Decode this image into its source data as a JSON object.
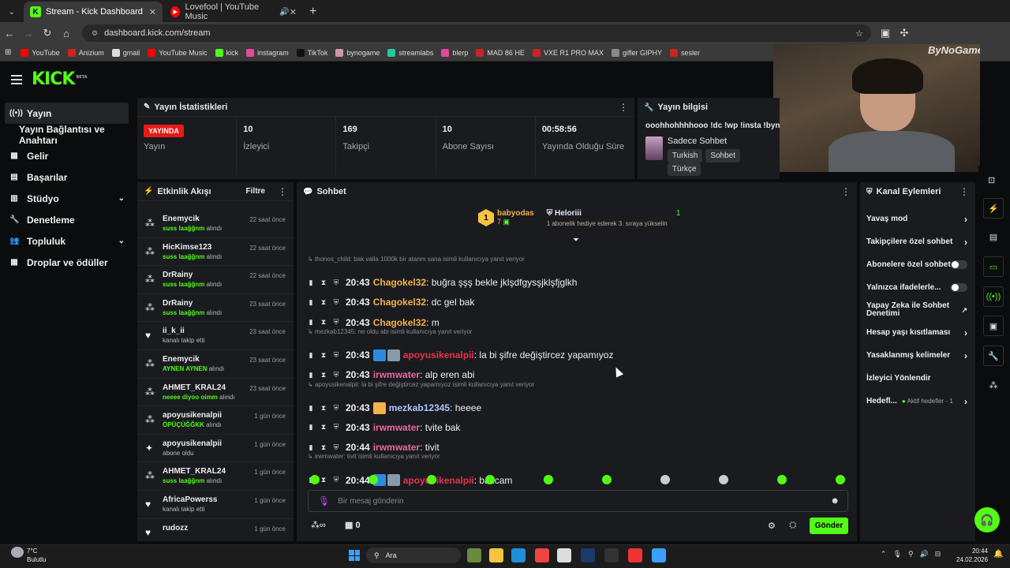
{
  "browser": {
    "tabs": [
      {
        "title": "Stream - Kick Dashboard",
        "active": true
      },
      {
        "title": "Lovefool | YouTube Music",
        "active": false
      }
    ],
    "url": "dashboard.kick.com/stream",
    "profile": "ByNoGame",
    "bookmarks": [
      "YouTube",
      "Anizium",
      "gmail",
      "YouTube Music",
      "kick",
      "instagram",
      "TikTok",
      "bynogame",
      "streamlabs",
      "blerp",
      "MAD 86 HE",
      "VXE R1 PRO MAX",
      "gifler GIPHY",
      "sesler"
    ]
  },
  "logo": {
    "text": "KICK",
    "beta": "BETA"
  },
  "sidebar": {
    "items": [
      {
        "label": "Yayın",
        "icon": "broadcast-icon",
        "active": true
      },
      {
        "label": "Yayın Bağlantısı ve Anahtarı",
        "icon": "",
        "active": false
      },
      {
        "label": "Gelir",
        "icon": "dollar-icon",
        "active": false
      },
      {
        "label": "Başarılar",
        "icon": "trophy-icon",
        "active": false
      },
      {
        "label": "Stüdyo",
        "icon": "studio-icon",
        "chevron": true
      },
      {
        "label": "Denetleme",
        "icon": "wrench-icon",
        "active": false
      },
      {
        "label": "Topluluk",
        "icon": "community-icon",
        "chevron": true
      },
      {
        "label": "Droplar ve ödüller",
        "icon": "gift-icon",
        "active": false
      }
    ]
  },
  "stats": {
    "title": "Yayın İstatistikleri",
    "live_badge": "YAYINDA",
    "items": [
      {
        "value": "",
        "label": "Yayın"
      },
      {
        "value": "10",
        "label": "İzleyici"
      },
      {
        "value": "169",
        "label": "Takipçi"
      },
      {
        "value": "10",
        "label": "Abone Sayısı"
      },
      {
        "value": "00:58:56",
        "label": "Yayında Olduğu Süre"
      }
    ]
  },
  "info": {
    "title": "Yayın bilgisi",
    "stream_title": "ooohhohhhhooo !dc !wp !insta !byno",
    "category": "Sadece Sohbet",
    "tags": [
      "Turkish",
      "Sohbet",
      "Türkçe"
    ]
  },
  "activity": {
    "title": "Etkinlik Akışı",
    "filter": "Filtre",
    "events": [
      {
        "name": "Enemycik",
        "detail_hl": "suss laağğnm",
        "detail": "alındı",
        "time": "22 saat önce",
        "icon": "points-icon"
      },
      {
        "name": "HicKimse123",
        "detail_hl": "suss laağğnm",
        "detail": "alındı",
        "time": "22 saat önce",
        "icon": "points-icon"
      },
      {
        "name": "DrRainy",
        "detail_hl": "suss laağğnm",
        "detail": "alındı",
        "time": "22 saat önce",
        "icon": "points-icon"
      },
      {
        "name": "DrRainy",
        "detail_hl": "suss laağğnm",
        "detail": "alındı",
        "time": "23 saat önce",
        "icon": "points-icon"
      },
      {
        "name": "ii_k_ii",
        "detail_hl": "",
        "detail": "kanalı takip etti",
        "time": "23 saat önce",
        "icon": "heart-icon"
      },
      {
        "name": "Enemycik",
        "detail_hl": "AYNEN AYNEN",
        "detail": "alındı",
        "time": "23 saat önce",
        "icon": "points-icon"
      },
      {
        "name": "AHMET_KRAL24",
        "detail_hl": "neeee diyoo oimm",
        "detail": "alındı",
        "time": "23 saat önce",
        "icon": "points-icon"
      },
      {
        "name": "apoyusikenalpii",
        "detail_hl": "ÖPÜÇÜĞĞKK",
        "detail": "alındı",
        "time": "1 gün önce",
        "icon": "points-icon"
      },
      {
        "name": "apoyusikenalpii",
        "detail_hl": "",
        "detail": "abone oldu",
        "time": "1 gün önce",
        "icon": "sparkle-icon"
      },
      {
        "name": "AHMET_KRAL24",
        "detail_hl": "suss laağğnm",
        "detail": "alındı",
        "time": "1 gün önce",
        "icon": "points-icon"
      },
      {
        "name": "AfricaPowerss",
        "detail_hl": "",
        "detail": "kanalı takip etti",
        "time": "1 gün önce",
        "icon": "heart-icon"
      },
      {
        "name": "rudozz",
        "detail_hl": "",
        "detail": "",
        "time": "1 gün önce",
        "icon": "heart-icon"
      }
    ]
  },
  "chat": {
    "title": "Sohbet",
    "leader1": {
      "name": "babyodas",
      "count": "7",
      "rank": "1"
    },
    "leader2": {
      "name": "Heloriii",
      "count": "1",
      "note": "1 abonelik hediye ederek 3. sıraya yükselin"
    },
    "partial_top": "20:43",
    "messages": [
      {
        "reply": "thonos_child: bak valla 1000k bir atanm sana isimli kullanıcıya yanıt veriyor"
      },
      {
        "time": "20:43",
        "user": "Chagokel32",
        "color": "#f5b14a",
        "text": ": buğra şşş bekle jklşdfgysşjklşfjglkh"
      },
      {
        "time": "20:43",
        "user": "Chagokel32",
        "color": "#f5b14a",
        "text": ": dc gel bak"
      },
      {
        "time": "20:43",
        "user": "Chagokel32",
        "color": "#f5b14a",
        "text": ": m"
      },
      {
        "reply": "mezkab12345: ne oldu abi isimli kullanıcıya yanıt veriyor"
      },
      {
        "time": "20:43",
        "user": "apoyusikenalpii",
        "color": "#e8334a",
        "text": ": la bi şifre değiştircez yapamıyoz",
        "badges": true
      },
      {
        "time": "20:43",
        "user": "irwmwater",
        "color": "#e86aa3",
        "text": ": alp eren abi"
      },
      {
        "reply": "apoyusikenalpii: la bi şifre değiştircez yapamıyoz isimli kullanıcıya yanıt veriyor"
      },
      {
        "time": "20:43",
        "user": "mezkab12345",
        "color": "#a9c9ff",
        "text": ": heeee",
        "crown": true
      },
      {
        "time": "20:43",
        "user": "irwmwater",
        "color": "#e86aa3",
        "text": ": tvite bak"
      },
      {
        "time": "20:44",
        "user": "irwmwater",
        "color": "#e86aa3",
        "text": ": tivit"
      },
      {
        "reply": "irwmwater: tivit isimli kullanıcıya yanıt veriyor"
      },
      {
        "time": "20:44",
        "user": "apoyusikenalpii",
        "color": "#e8334a",
        "text": ": bakcam",
        "badges": true
      }
    ],
    "input_placeholder": "Bir mesaj gönderin",
    "points": "0",
    "send": "Gönder"
  },
  "actions": {
    "title": "Kanal Eylemleri",
    "items": [
      {
        "label": "Yavaş mod",
        "type": "chevron"
      },
      {
        "label": "Takipçilere özel sohbet",
        "type": "chevron"
      },
      {
        "label": "Abonelere özel sohbet",
        "type": "toggle"
      },
      {
        "label": "Yalnızca ifadelerle...",
        "type": "toggle"
      },
      {
        "label": "Yapay Zeka ile Sohbet Denetimi",
        "type": "external"
      },
      {
        "label": "Hesap yaşı kısıtlaması",
        "type": "chevron"
      },
      {
        "label": "Yasaklanmış kelimeler",
        "type": "chevron"
      },
      {
        "label": "İzleyici Yönlendir",
        "type": "none"
      },
      {
        "label": "Hedefl...",
        "type": "chevron",
        "extra": "Aktif hedefler - 1"
      }
    ]
  },
  "taskbar": {
    "weather_temp": "7°C",
    "weather_desc": "Bulutlu",
    "search": "Ara",
    "time": "20:44",
    "date": "24.02.2026"
  },
  "colors": {
    "accent": "#53fc18",
    "live": "#e91916"
  }
}
